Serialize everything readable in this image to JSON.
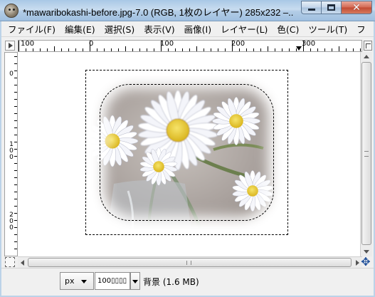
{
  "window": {
    "title": "*mawaribokashi-before.jpg-7.0 (RGB, 1枚のレイヤー) 285x232 –...",
    "app_icon": "gimp-wilber-icon",
    "controls": {
      "minimize_icon": "minimize-icon",
      "maximize_icon": "maximize-icon",
      "close_icon": "close-icon",
      "close_glyph": "✕"
    }
  },
  "menubar": {
    "items": [
      {
        "label": "ファイル(F)"
      },
      {
        "label": "編集(E)"
      },
      {
        "label": "選択(S)"
      },
      {
        "label": "表示(V)"
      },
      {
        "label": "画像(I)"
      },
      {
        "label": "レイヤー(L)"
      },
      {
        "label": "色(C)"
      },
      {
        "label": "ツール(T)"
      },
      {
        "label": "フ"
      }
    ]
  },
  "rulers": {
    "horizontal_labels": [
      "100",
      "0",
      "100",
      "200",
      "300"
    ],
    "vertical_labels": [
      "0",
      "100",
      "200"
    ]
  },
  "image": {
    "description_icon": "daisy-photo",
    "selection": "rounded-rectangle"
  },
  "scroll": {
    "nav_icon": "navigate-move-icon",
    "nav_glyph": "✥"
  },
  "statusbar": {
    "unit": "px",
    "zoom": "100",
    "zoom_box": "▯▯▯▯",
    "layer_info": "背景 (1.6 MB)"
  }
}
